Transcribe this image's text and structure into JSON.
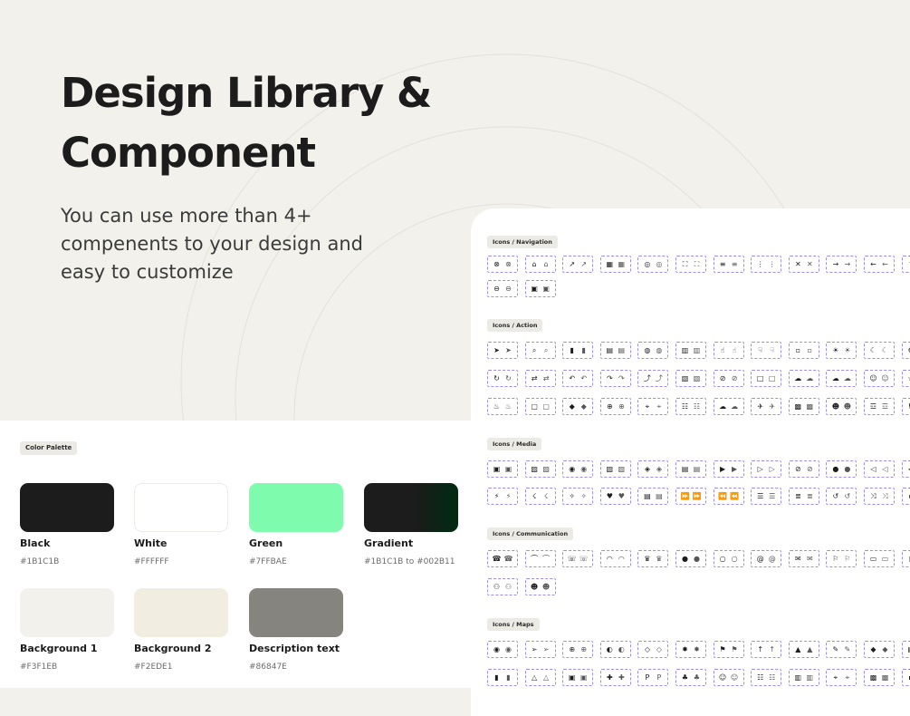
{
  "hero": {
    "title_lines": [
      "Design Library &",
      "Component"
    ],
    "subtitle_lines": [
      "You can use more than 4+",
      "compenents to your design and",
      "easy to customize"
    ]
  },
  "palette": {
    "tag": "Color Palette",
    "swatches": [
      {
        "name": "Black",
        "hex": "#1B1C1B",
        "color": "#1B1C1B"
      },
      {
        "name": "White",
        "hex": "#FFFFFF",
        "color": "#FFFFFF"
      },
      {
        "name": "Green",
        "hex": "#7FFBAE",
        "color": "#7FFBAE"
      },
      {
        "name": "Gradient",
        "hex": "#1B1C1B to #002B11",
        "color_from": "#1B1C1B",
        "color_to": "#002B11"
      },
      {
        "name": "Background 1",
        "hex": "#F3F1EB",
        "color": "#F3F1EB"
      },
      {
        "name": "Background 2",
        "hex": "#F2EDE1",
        "color": "#F2EDE1"
      },
      {
        "name": "Description text",
        "hex": "#86847E",
        "color": "#86847E"
      }
    ]
  },
  "icons": {
    "sections": [
      {
        "tag": "Icons / Navigation",
        "rows": [
          [
            "close-circle-icon",
            "home-icon",
            "external-link-icon",
            "grid-icon",
            "compass-icon",
            "fullscreen-icon",
            "menu-icon",
            "more-icon",
            "close-icon",
            "arrow-right-icon",
            "arrow-left-icon",
            "arrow-up-icon"
          ],
          [
            "minus-circle-icon",
            "image-frame-icon"
          ]
        ]
      },
      {
        "tag": "Icons / Action",
        "rows": [
          [
            "send-icon",
            "search-icon",
            "delete-icon",
            "dashboard-icon",
            "globe-icon",
            "calendar-icon",
            "thumb-up-icon",
            "thumb-down-icon",
            "feedback-icon",
            "sun-icon",
            "moon-icon",
            "settings-icon"
          ],
          [
            "refresh-icon",
            "sync-icon",
            "undo-icon",
            "redo-icon",
            "share-icon",
            "print-icon",
            "block-icon",
            "document-icon",
            "cloud-upload-icon",
            "cloud-off-icon",
            "face-icon",
            "star-icon"
          ],
          [
            "fire-icon",
            "text-box-icon",
            "drop-icon",
            "add-circle-icon",
            "target-icon",
            "translate-icon",
            "cloud-download-icon",
            "rocket-icon",
            "layout-icon",
            "add-user-icon",
            "group-icon",
            "flag-icon"
          ]
        ]
      },
      {
        "tag": "Icons / Media",
        "rows": [
          [
            "image-icon",
            "image-off-icon",
            "camera-icon",
            "camera-off-icon",
            "photo-camera-icon",
            "movie-icon",
            "video-icon",
            "video-off-icon",
            "mic-off-icon",
            "mic-icon",
            "volume-off-icon",
            "volume-icon"
          ],
          [
            "flash-icon",
            "flash-off-icon",
            "magic-icon",
            "heart-icon",
            "subtitles-icon",
            "fast-forward-icon",
            "rewind-icon",
            "queue-icon",
            "playlist-icon",
            "repeat-icon",
            "shuffle-icon",
            "play-icon"
          ]
        ]
      },
      {
        "tag": "Icons / Communication",
        "rows": [
          [
            "phone-icon",
            "hang-up-icon",
            "phone-forward-icon",
            "headset-icon",
            "crown-icon",
            "apple-icon",
            "whatsapp-icon",
            "at-icon",
            "mail-icon",
            "chat-flag-icon",
            "chat-icon",
            "comment-icon"
          ],
          [
            "group-chat-icon",
            "contact-icon"
          ]
        ]
      },
      {
        "tag": "Icons / Maps",
        "rows": [
          [
            "location-pin-icon",
            "navigation-icon",
            "gps-icon",
            "compass-nav-icon",
            "place-icon",
            "nearby-icon",
            "signpost-icon",
            "directions-icon",
            "terrain-icon",
            "draw-icon",
            "directions-alt-icon",
            "map-icon"
          ],
          [
            "trash-map-icon",
            "museum-icon",
            "store-icon",
            "hospital-icon",
            "parking-icon",
            "park-icon",
            "person-pin-icon",
            "railway-icon",
            "train-icon",
            "scan-icon",
            "bus-icon",
            "pin-icon"
          ]
        ]
      }
    ]
  }
}
